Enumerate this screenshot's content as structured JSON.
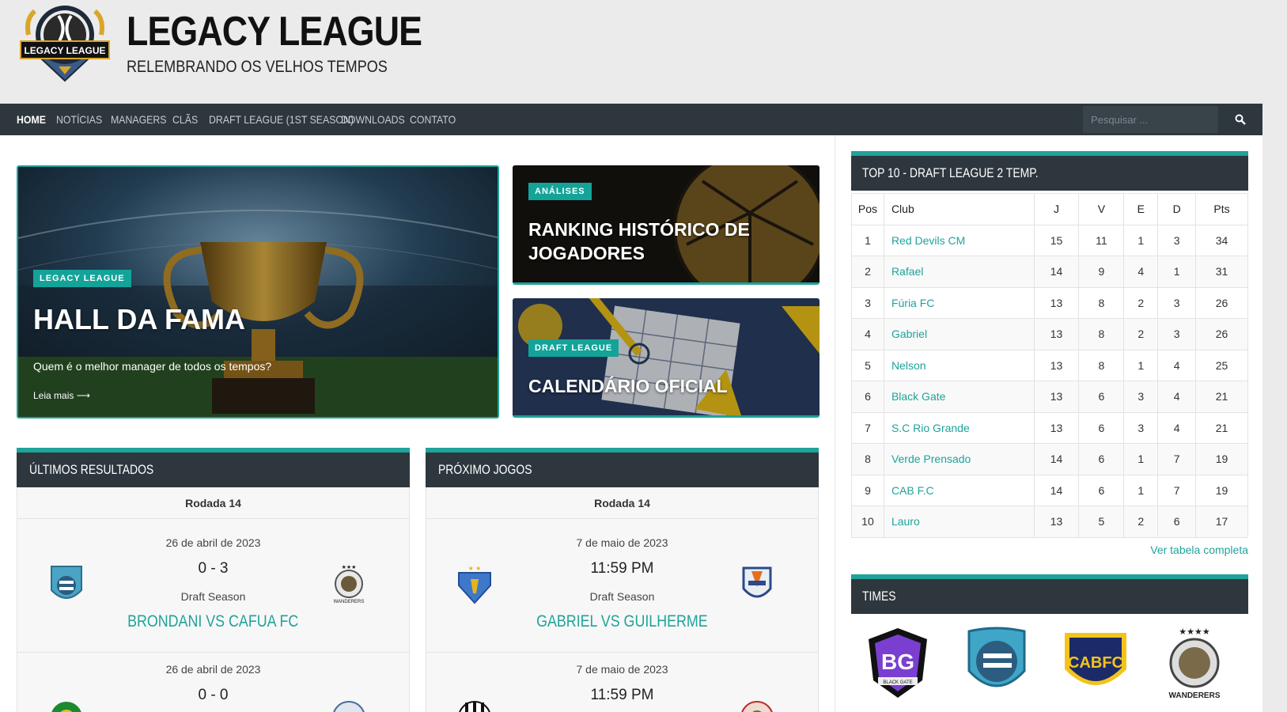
{
  "header": {
    "logo_text": "LEGACY LEAGUE",
    "site_title": "LEGACY LEAGUE",
    "tagline": "RELEMBRANDO OS VELHOS TEMPOS"
  },
  "nav": {
    "items": [
      {
        "label": "HOME"
      },
      {
        "label": "NOTÍCIAS"
      },
      {
        "label": "MANAGERS"
      },
      {
        "label": "CLÃS"
      },
      {
        "label": "DRAFT LEAGUE (1ST SEASON)"
      },
      {
        "label": "DOWNLOADS"
      },
      {
        "label": "CONTATO"
      }
    ],
    "search_placeholder": "Pesquisar ..."
  },
  "featured": {
    "main": {
      "tag": "LEGACY LEAGUE",
      "title": "HALL DA FAMA",
      "excerpt": "Quem é o melhor manager de todos os tempos?",
      "read_more": "Leia mais"
    },
    "side1": {
      "tag": "ANÁLISES",
      "title": "RANKING HISTÓRICO DE JOGADORES"
    },
    "side2": {
      "tag": "DRAFT LEAGUE",
      "title": "CALENDÁRIO OFICIAL"
    }
  },
  "results": {
    "heading": "ÚLTIMOS RESULTADOS",
    "round": "Rodada 14",
    "matches": [
      {
        "date": "26 de abril de 2023",
        "score": "0 - 3",
        "competition": "Draft Season",
        "title": "BRONDANI VS CAFUA FC"
      },
      {
        "date": "26 de abril de 2023",
        "score": "0 - 0"
      }
    ]
  },
  "upcoming": {
    "heading": "PRÓXIMO JOGOS",
    "round": "Rodada 14",
    "matches": [
      {
        "date": "7 de maio de 2023",
        "time": "11:59 PM",
        "competition": "Draft Season",
        "title": "GABRIEL VS GUILHERME"
      },
      {
        "date": "7 de maio de 2023",
        "time": "11:59 PM"
      }
    ]
  },
  "standings": {
    "heading": "TOP 10 - DRAFT LEAGUE 2 TEMP.",
    "columns": [
      "Pos",
      "Club",
      "J",
      "V",
      "E",
      "D",
      "Pts"
    ],
    "rows": [
      [
        "1",
        "Red Devils CM",
        "15",
        "11",
        "1",
        "3",
        "34"
      ],
      [
        "2",
        "Rafael",
        "14",
        "9",
        "4",
        "1",
        "31"
      ],
      [
        "3",
        "Fúria FC",
        "13",
        "8",
        "2",
        "3",
        "26"
      ],
      [
        "4",
        "Gabriel",
        "13",
        "8",
        "2",
        "3",
        "26"
      ],
      [
        "5",
        "Nelson",
        "13",
        "8",
        "1",
        "4",
        "25"
      ],
      [
        "6",
        "Black Gate",
        "13",
        "6",
        "3",
        "4",
        "21"
      ],
      [
        "7",
        "S.C Rio Grande",
        "13",
        "6",
        "3",
        "4",
        "21"
      ],
      [
        "8",
        "Verde Prensado",
        "14",
        "6",
        "1",
        "7",
        "19"
      ],
      [
        "9",
        "CAB F.C",
        "14",
        "6",
        "1",
        "7",
        "19"
      ],
      [
        "10",
        "Lauro",
        "13",
        "5",
        "2",
        "6",
        "17"
      ]
    ],
    "see_all": "Ver tabela completa"
  },
  "teams": {
    "heading": "TIMES",
    "logos": [
      "BG",
      "BLACK GATE",
      "CABFC",
      "WANDERERS"
    ]
  },
  "colors": {
    "accent": "#1fa39a",
    "dark": "#2e373d"
  }
}
